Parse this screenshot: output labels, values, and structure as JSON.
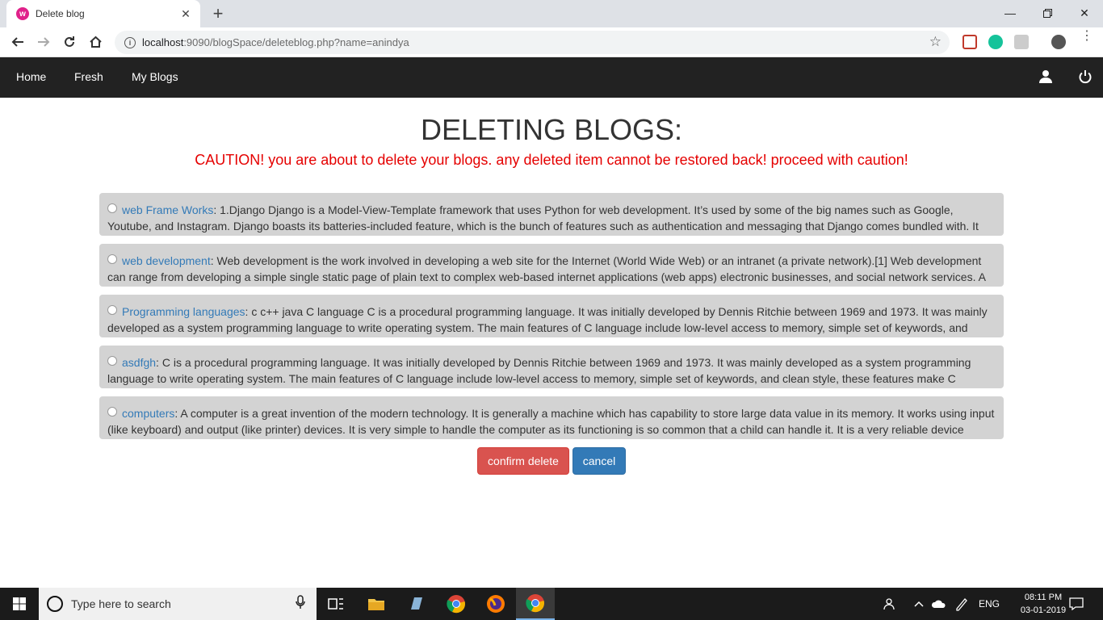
{
  "browser": {
    "tab_title": "Delete blog",
    "favicon_text": "w",
    "url_host": "localhost",
    "url_rest": ":9090/blogSpace/deleteblog.php?name=anindya"
  },
  "navbar": {
    "items": [
      "Home",
      "Fresh",
      "My Blogs"
    ]
  },
  "page": {
    "heading": "DELETING BLOGS:",
    "caution": "CAUTION! you are about to delete your blogs. any deleted item cannot be restored back! proceed with caution!"
  },
  "blogs": [
    {
      "title": "web Frame Works",
      "text": "1.Django Django is a Model-View-Template framework that uses Python for web development. It’s used by some of the big names such as Google, Youtube, and Instagram. Django boasts its batteries-included feature, which is the bunch of features such as authentication and messaging that Django comes bundled with. It"
    },
    {
      "title": "web development",
      "text": "Web development is the work involved in developing a web site for the Internet (World Wide Web) or an intranet (a private network).[1] Web development can range from developing a simple single static page of plain text to complex web-based internet applications (web apps) electronic businesses, and social network services. A"
    },
    {
      "title": "Programming languages",
      "text": "c c++ java C language C is a procedural programming language. It was initially developed by Dennis Ritchie between 1969 and 1973. It was mainly developed as a system programming language to write operating system. The main features of C language include low-level access to memory, simple set of keywords, and"
    },
    {
      "title": "asdfgh",
      "text": "C is a procedural programming language. It was initially developed by Dennis Ritchie between 1969 and 1973. It was mainly developed as a system programming language to write operating system. The main features of C language include low-level access to memory, simple set of keywords, and clean style, these features make C"
    },
    {
      "title": "computers",
      "text": "A computer is a great invention of the modern technology. It is generally a machine which has capability to store large data value in its memory. It works using input (like keyboard) and output (like printer) devices. It is very simple to handle the computer as its functioning is so common that a child can handle it. It is a very reliable device"
    }
  ],
  "buttons": {
    "confirm": "confirm delete",
    "cancel": "cancel"
  },
  "taskbar": {
    "search_placeholder": "Type here to search",
    "lang": "ENG",
    "time": "08:11 PM",
    "date": "03-01-2019"
  },
  "colors": {
    "navbar_bg": "#222222",
    "caution": "#e50000",
    "danger": "#d9534f",
    "primary": "#337ab7",
    "blog_bg": "#d3d3d3",
    "link": "#337ab7"
  }
}
